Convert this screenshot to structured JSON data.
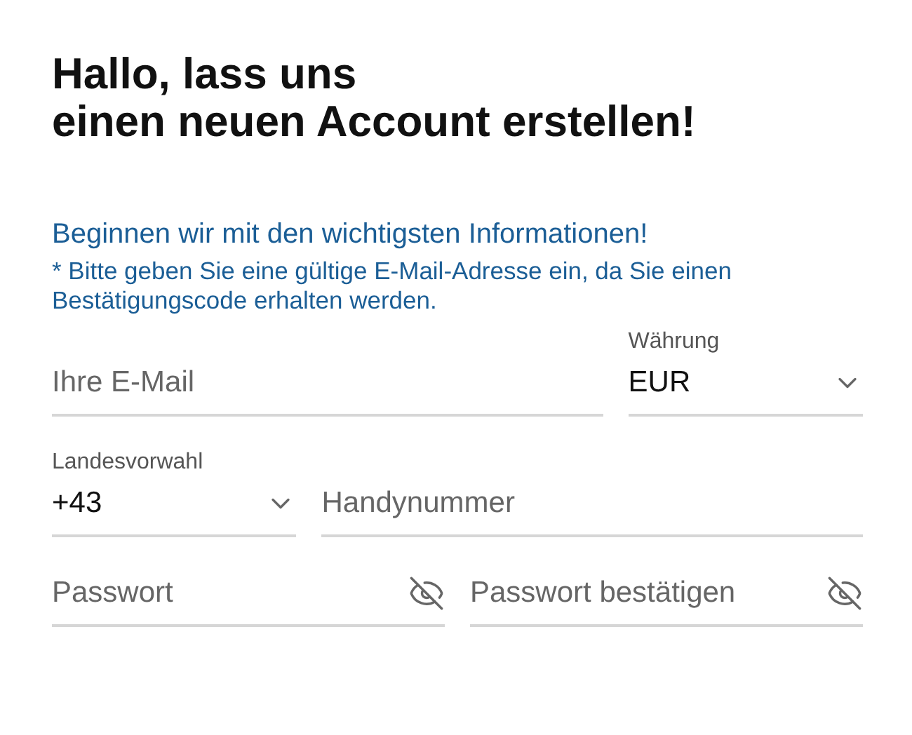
{
  "heading": {
    "lines": [
      "Hallo, lass uns",
      "einen neuen Account erstellen!"
    ]
  },
  "intro": "Beginnen wir mit den wichtigsten Informationen!",
  "note": "* Bitte geben Sie eine gültige E-Mail-Adresse ein, da Sie einen Bestätigungscode erhalten werden.",
  "rows": [
    {
      "fields": [
        {
          "kind": "text",
          "placeholder": "Ihre E-Mail"
        },
        {
          "kind": "select",
          "label": "Währung",
          "value": "EUR"
        }
      ]
    },
    {
      "fields": [
        {
          "kind": "select",
          "label": "Landesvorwahl",
          "value": "+43"
        },
        {
          "kind": "text",
          "placeholder": "Handynummer"
        }
      ]
    },
    {
      "fields": [
        {
          "kind": "password",
          "placeholder": "Passwort"
        },
        {
          "kind": "password",
          "placeholder": "Passwort bestätigen"
        }
      ]
    }
  ]
}
